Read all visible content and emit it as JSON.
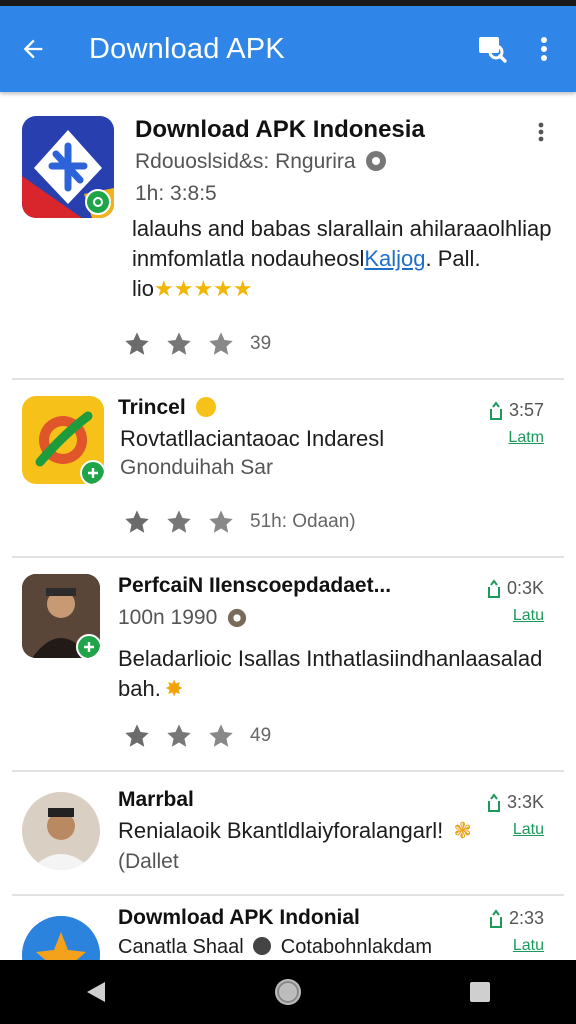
{
  "appbar": {
    "title": "Download APK"
  },
  "apps": [
    {
      "title": "Download APK Indonesia",
      "developer": "Rdouoslsid&s: Rngurira",
      "meta": "1h: 3:8:5",
      "desc_line1": "lalauhs and babas slarallain ahilaraaolhliap",
      "desc_line2_pre": "inmfomlatla nodauheosl",
      "desc_line2_link": "Kaljog",
      "desc_line2_post": ". Pall.",
      "desc_line3": "lio",
      "stars_text": "★★★★★",
      "rating_count": "39"
    },
    {
      "title": "Trincel",
      "line1": "Rovtatllaciantaoac Indaresl",
      "line2": "Gnonduihah Sar",
      "rating_count": "51h: Odaan)",
      "size": "3:57",
      "link": "Latm"
    },
    {
      "title": "PerfcaiN IIenscoepdadaet...",
      "meta": "100n 1990",
      "desc_line1": "Beladarlioic Isallas Inthatlasiindhanlaasalad",
      "desc_line2": "bah.",
      "rating_count": "49",
      "size": "0:3K",
      "link": "Latu"
    },
    {
      "title": "Marrbal",
      "line1": "Renialaoik Bkantldlaiyforalangarl!",
      "line2": "(Dallet",
      "size": "3:3K",
      "link": "Latu"
    },
    {
      "title": "Dowmload APK Indonial",
      "line1": "Canatla Shaal",
      "line1_post": "Cotabohnlakdam",
      "size": "2:33",
      "link": "Latu"
    }
  ]
}
